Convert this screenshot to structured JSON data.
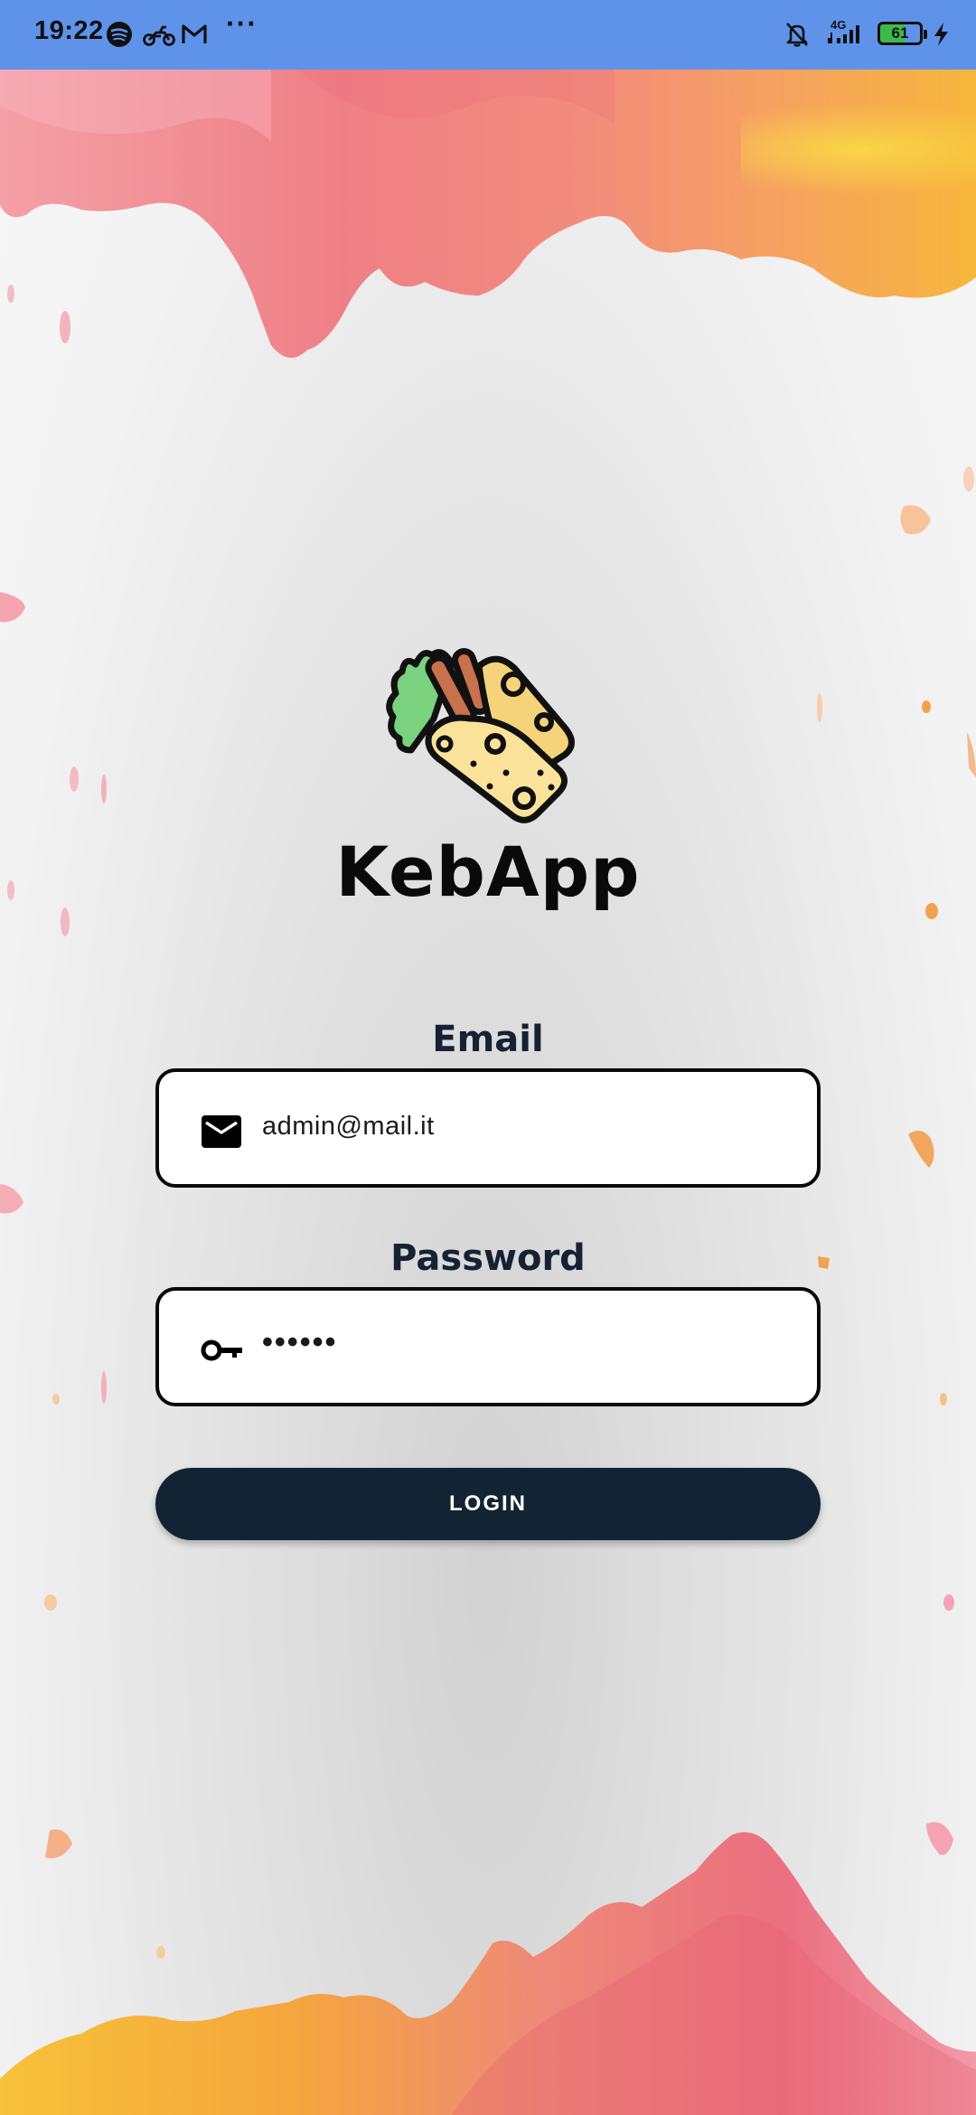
{
  "status_bar": {
    "time": "19:22",
    "network": "4G",
    "battery": "61",
    "overflow": "···",
    "icons": [
      "spotify-icon",
      "motorbike-icon",
      "gmail-icon",
      "notifications-off-icon",
      "signal-icon",
      "battery-icon",
      "charging-icon"
    ]
  },
  "app": {
    "name": "KebApp",
    "logo_icon": "kebab-wrap-icon"
  },
  "form": {
    "email_label": "Email",
    "email_value": "admin@mail.it",
    "email_icon": "envelope-icon",
    "password_label": "Password",
    "password_value": "••••••",
    "password_icon": "key-icon",
    "login_label": "LOGIN"
  },
  "colors": {
    "status_bar": "#5f93ea",
    "button": "#122333",
    "label_text": "#142233"
  }
}
